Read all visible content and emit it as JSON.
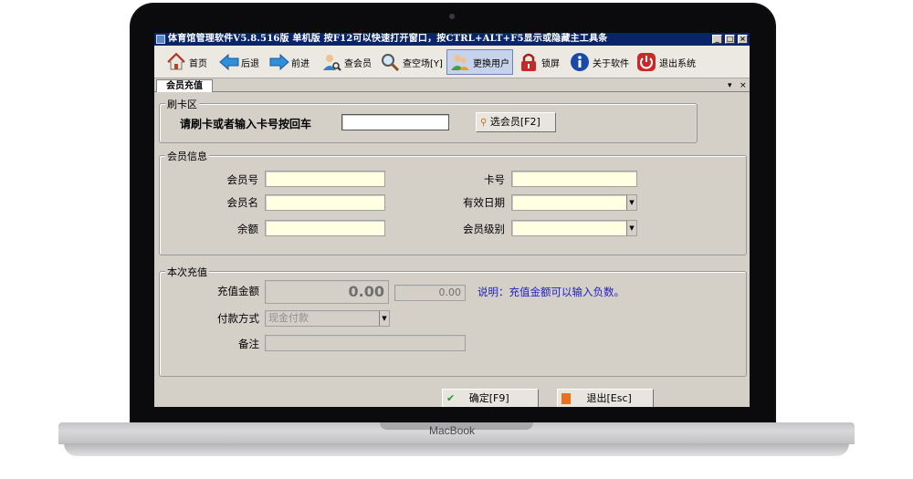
{
  "window": {
    "title": "体育馆管理软件V5.8.516版 单机版 按F12可以快速打开窗口，按CTRL+ALT+F5显示或隐藏主工具条",
    "minimize": "_",
    "maximize": "□",
    "close": "×"
  },
  "toolbar": {
    "home": "首页",
    "back": "后退",
    "forward": "前进",
    "query_member": "查会员",
    "query_venue": "查空场[Y]",
    "switch_user": "更换用户",
    "lock": "锁屏",
    "about": "关于软件",
    "exit": "退出系统"
  },
  "tab": {
    "label": "会员充值",
    "pin": "▾",
    "close": "×"
  },
  "card_section": {
    "title": "刷卡区",
    "prompt": "请刷卡或者输入卡号按回车",
    "card_value": "",
    "select_member": "选会员[F2]"
  },
  "member_info": {
    "title": "会员信息",
    "member_no": "会员号",
    "card_no": "卡号",
    "member_name": "会员名",
    "valid_date": "有效日期",
    "balance": "余额",
    "member_level": "会员级别"
  },
  "recharge": {
    "title": "本次充值",
    "amount_label": "充值金额",
    "amount_value": "0.00",
    "amount_value2": "0.00",
    "note": "说明：充值金额可以输入负数。",
    "pay_label": "付款方式",
    "pay_value": "现金付款",
    "remark_label": "备注"
  },
  "actions": {
    "confirm": "确定[F9]",
    "exit": "退出[Esc]"
  },
  "laptop": {
    "brand": "MacBook"
  }
}
